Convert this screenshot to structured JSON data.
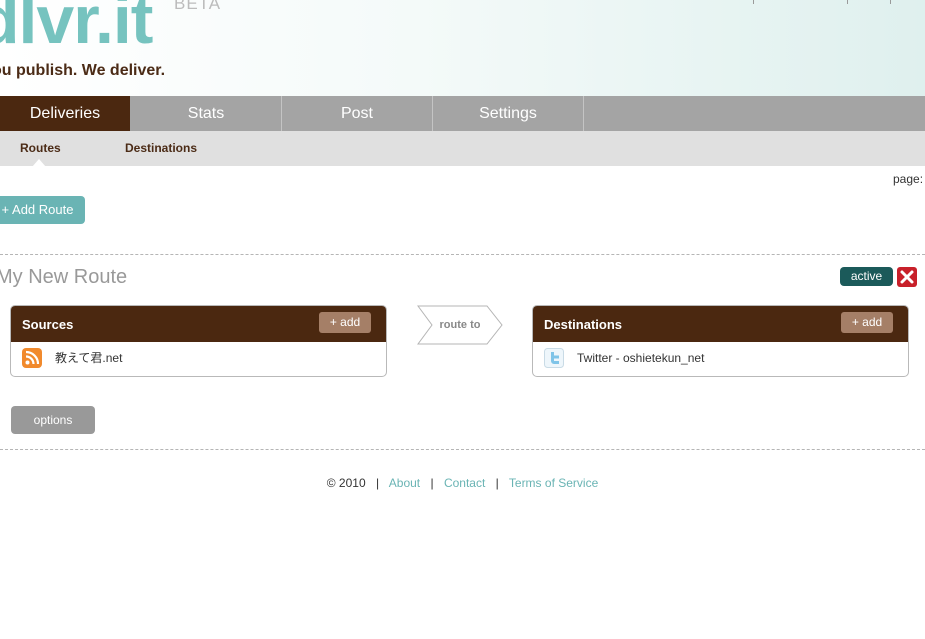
{
  "header": {
    "logo": "dlvr.it",
    "badge": "BETA",
    "tagline": "ou publish. We deliver."
  },
  "main_nav": {
    "tabs": [
      {
        "label": "Deliveries",
        "active": true
      },
      {
        "label": "Stats",
        "active": false
      },
      {
        "label": "Post",
        "active": false
      },
      {
        "label": "Settings",
        "active": false
      }
    ]
  },
  "sub_nav": {
    "items": [
      {
        "label": "Routes",
        "active": true
      },
      {
        "label": "Destinations",
        "active": false
      }
    ]
  },
  "page_info": "page:",
  "add_route_label": "+ Add Route",
  "route": {
    "name": "My New Route",
    "status": "active",
    "sources": {
      "title": "Sources",
      "add_label": "+ add",
      "items": [
        {
          "icon": "rss-icon",
          "label": "教えて君.net"
        }
      ]
    },
    "connector": "route to",
    "destinations": {
      "title": "Destinations",
      "add_label": "+ add",
      "items": [
        {
          "icon": "twitter-icon",
          "label": "Twitter - oshietekun_net"
        }
      ]
    },
    "options_label": "options"
  },
  "footer": {
    "copyright": "© 2010",
    "links": [
      "About",
      "Contact",
      "Terms of Service"
    ]
  },
  "colors": {
    "brand_brown": "#4b2810",
    "teal": "#6ab4b4",
    "nav_gray": "#a4a4a4",
    "danger_red": "#c8202a"
  }
}
